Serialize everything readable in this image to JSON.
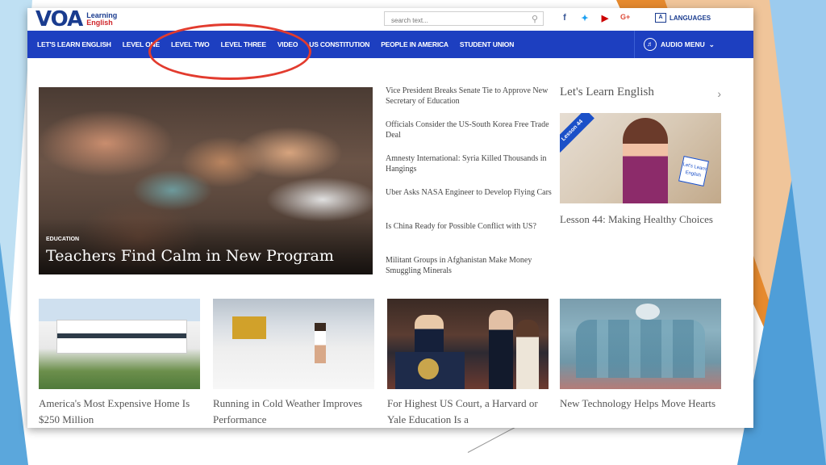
{
  "header": {
    "logo_text": "VOA",
    "logo_sub1": "Learning",
    "logo_sub2": "English",
    "search_placeholder": "search text...",
    "languages_label": "LANGUAGES"
  },
  "nav": {
    "items": [
      "LET'S LEARN ENGLISH",
      "LEVEL ONE",
      "LEVEL TWO",
      "LEVEL THREE",
      "VIDEO",
      "US CONSTITUTION",
      "PEOPLE IN AMERICA",
      "STUDENT UNION"
    ],
    "audio_menu": "AUDIO MENU"
  },
  "hero": {
    "category": "EDUCATION",
    "title": "Teachers Find Calm in New Program"
  },
  "news_list": [
    "Vice President Breaks Senate Tie to Approve New Secretary of Education",
    "Officials Consider the US-South Korea Free Trade Deal",
    "Amnesty International: Syria Killed Thousands in Hangings",
    "Uber Asks NASA Engineer to Develop Flying Cars",
    "Is China Ready for Possible Conflict with US?",
    "Militant Groups in Afghanistan Make Money Smuggling Minerals"
  ],
  "lets_learn": {
    "title": "Let's Learn English",
    "banner": "Lesson 44",
    "logo_text": "Let's Learn English",
    "caption": "Lesson 44: Making Healthy Choices"
  },
  "stories": [
    "America's Most Expensive Home Is $250 Million",
    "Running in Cold Weather Improves Performance",
    "For Highest US Court, a Harvard or Yale Education Is a",
    "New Technology Helps Move Hearts"
  ],
  "colors": {
    "nav_bg": "#1d3fc0",
    "brand": "#1a3c8f",
    "highlight": "#e23b2e"
  },
  "icons": {
    "search": "search-icon",
    "facebook": "facebook-icon",
    "twitter": "twitter-icon",
    "youtube": "youtube-icon",
    "googleplus": "googleplus-icon",
    "languages": "languages-icon",
    "audio": "speaker-icon",
    "chevron": "chevron-right-icon"
  }
}
